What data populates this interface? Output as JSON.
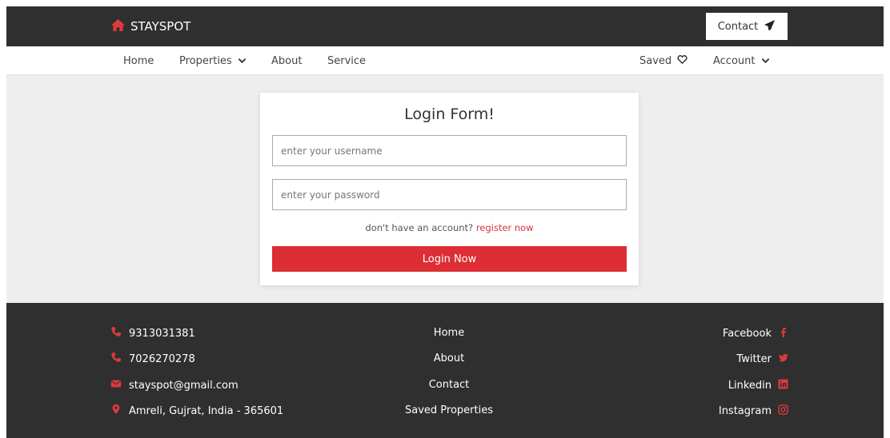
{
  "brand": {
    "name": "STAYSPOT",
    "icon": "home-icon",
    "accent": "#dc2e34"
  },
  "header": {
    "contact_label": "Contact",
    "contact_icon": "paper-plane-icon"
  },
  "nav": {
    "home": "Home",
    "properties": "Properties",
    "about": "About",
    "service": "Service",
    "saved": "Saved",
    "account": "Account"
  },
  "login_form": {
    "title": "Login Form!",
    "username_placeholder": "enter your username",
    "password_placeholder": "enter your password",
    "register_prompt": "don't have an account?",
    "register_link": "register now",
    "submit_label": "Login Now"
  },
  "footer": {
    "contacts": [
      {
        "icon": "phone-icon",
        "text": "9313031381"
      },
      {
        "icon": "phone-icon",
        "text": "7026270278"
      },
      {
        "icon": "envelope-icon",
        "text": "stayspot@gmail.com"
      },
      {
        "icon": "map-marker-icon",
        "text": "Amreli, Gujrat, India - 365601"
      }
    ],
    "links": [
      "Home",
      "About",
      "Contact",
      "Saved Properties"
    ],
    "socials": [
      {
        "label": "Facebook",
        "icon": "facebook-icon"
      },
      {
        "label": "Twitter",
        "icon": "twitter-icon"
      },
      {
        "label": "Linkedin",
        "icon": "linkedin-icon"
      },
      {
        "label": "Instagram",
        "icon": "instagram-icon"
      }
    ]
  }
}
